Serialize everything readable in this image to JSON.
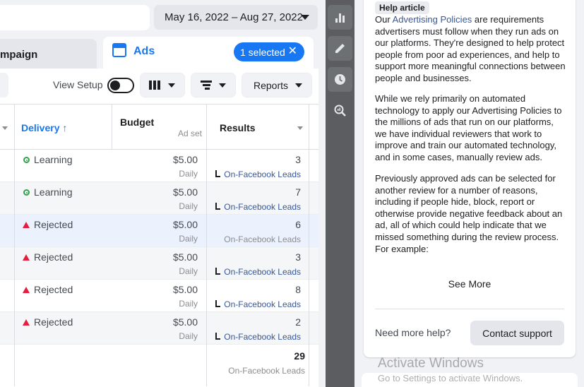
{
  "header": {
    "date_range": "May 16, 2022 – Aug 27, 2022"
  },
  "tabs": {
    "campaign_label": "mpaign",
    "ads_label": "Ads",
    "selected_label": "1 selected",
    "clear_symbol": "✕"
  },
  "toolbar": {
    "view_setup_label": "View Setup",
    "view_setup_on": false,
    "reports_label": "Reports"
  },
  "table": {
    "headers": {
      "delivery": "Delivery ↑",
      "budget": "Budget",
      "budget_sub": "Ad set",
      "results": "Results"
    },
    "rows": [
      {
        "status": "Learning",
        "status_kind": "learning",
        "budget": "$5.00",
        "budget_period": "Daily",
        "result": "3",
        "result_type": "On-Facebook Leads",
        "linked": true,
        "selected": false
      },
      {
        "status": "Learning",
        "status_kind": "learning",
        "budget": "$5.00",
        "budget_period": "Daily",
        "result": "7",
        "result_type": "On-Facebook Leads",
        "linked": true,
        "selected": false
      },
      {
        "status": "Rejected",
        "status_kind": "rejected",
        "budget": "$5.00",
        "budget_period": "Daily",
        "result": "6",
        "result_type": "On-Facebook Leads",
        "linked": false,
        "selected": true
      },
      {
        "status": "Rejected",
        "status_kind": "rejected",
        "budget": "$5.00",
        "budget_period": "Daily",
        "result": "3",
        "result_type": "On-Facebook Leads",
        "linked": true,
        "selected": false
      },
      {
        "status": "Rejected",
        "status_kind": "rejected",
        "budget": "$5.00",
        "budget_period": "Daily",
        "result": "8",
        "result_type": "On-Facebook Leads",
        "linked": true,
        "selected": false
      },
      {
        "status": "Rejected",
        "status_kind": "rejected",
        "budget": "$5.00",
        "budget_period": "Daily",
        "result": "2",
        "result_type": "On-Facebook Leads",
        "linked": true,
        "selected": false
      }
    ],
    "total": {
      "value": "29",
      "label": "On-Facebook Leads"
    }
  },
  "side_rail": {
    "icons": [
      "bar-chart-icon",
      "pencil-icon",
      "clock-icon",
      "magnify-chart-icon"
    ]
  },
  "help": {
    "badge": "Help article",
    "p1_prefix": "Our ",
    "p1_link": "Advertising Policies",
    "p1_suffix": " are requirements advertisers must follow when they run ads on our platforms. They're designed to help protect people from poor ad experiences, and help to support more meaningful connections between people and businesses.",
    "p2": "While we rely primarily on automated technology to apply our Advertising Policies to the millions of ads that run on our platforms, we have individual reviewers that work to improve and train our automated technology, and in some cases, manually review ads.",
    "p3": "Previously approved ads can be selected for another review for a number of reasons, including if people hide, block, report or otherwise provide negative feedback about an ad, all of which could help indicate that we missed something during the review process. For example:",
    "see_more": "See More",
    "need_help": "Need more help?",
    "contact_support": "Contact support"
  },
  "watermark": {
    "line1": "Activate Windows",
    "line2": "Go to Settings to activate Windows."
  },
  "colors": {
    "accent": "#1877f2",
    "link": "#385898",
    "learning": "#31a24c",
    "rejected": "#e41e3f",
    "rail": "#5b5d60"
  }
}
